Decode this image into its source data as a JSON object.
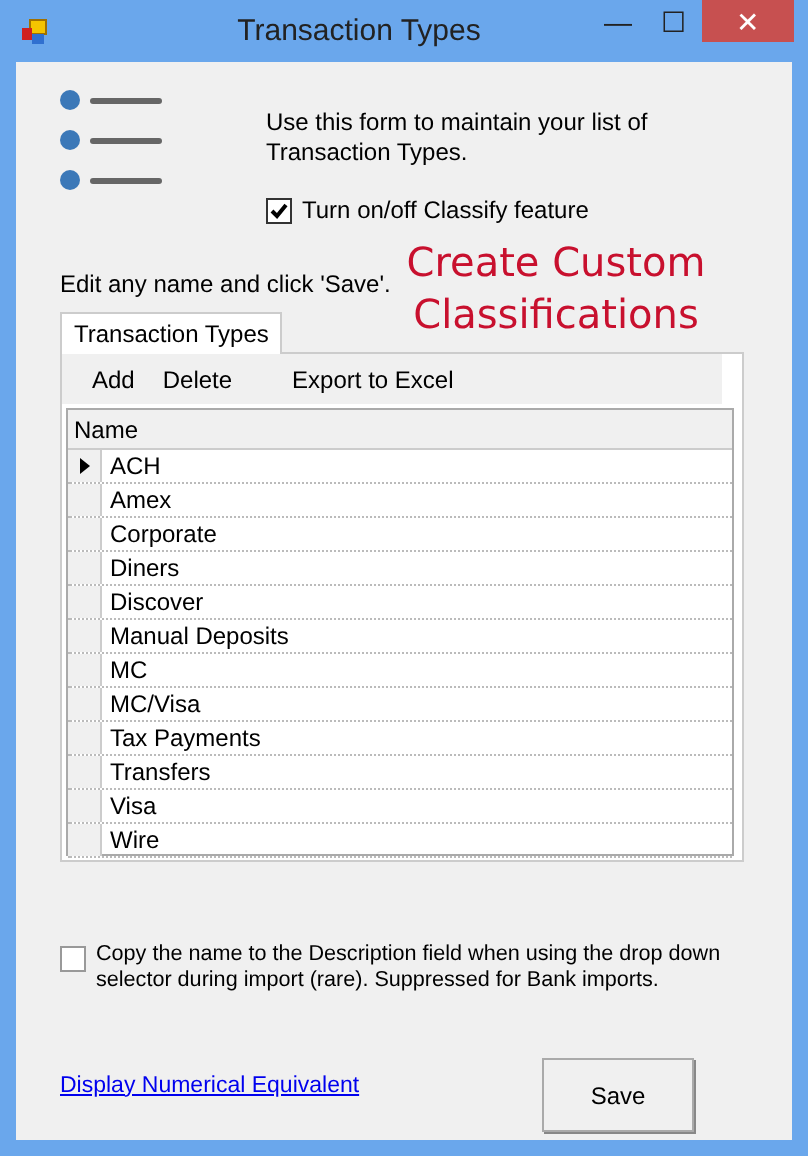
{
  "window": {
    "title": "Transaction Types",
    "buttons": [
      "—",
      "☐",
      "✕"
    ]
  },
  "description": "Use this form to maintain your list of Transaction Types.",
  "classify": {
    "label": "Turn on/off Classify feature",
    "checked": true
  },
  "edit_hint": "Edit any name and click 'Save'.",
  "banner": "Create Custom Classifications",
  "tabs": [
    {
      "label": "Transaction Types",
      "selected": true
    }
  ],
  "toolbar": [
    "Add",
    "Delete",
    "Export to Excel"
  ],
  "table": {
    "columns": [
      "Name"
    ],
    "rows": [
      {
        "name": "ACH",
        "selected": true
      },
      {
        "name": "Amex",
        "selected": false
      },
      {
        "name": "Corporate",
        "selected": false
      },
      {
        "name": "Diners",
        "selected": false
      },
      {
        "name": "Discover",
        "selected": false
      },
      {
        "name": "Manual Deposits",
        "selected": false
      },
      {
        "name": "MC",
        "selected": false
      },
      {
        "name": "MC/Visa",
        "selected": false
      },
      {
        "name": "Tax Payments",
        "selected": false
      },
      {
        "name": "Transfers",
        "selected": false
      },
      {
        "name": "Visa",
        "selected": false
      },
      {
        "name": "Wire",
        "selected": false
      }
    ]
  },
  "copy_option": {
    "label": "Copy the name to the Description field when using the drop down selector during import (rare). Suppressed for Bank imports.",
    "checked": false
  },
  "link": "Display Numerical Equivalent",
  "save_button": "Save"
}
